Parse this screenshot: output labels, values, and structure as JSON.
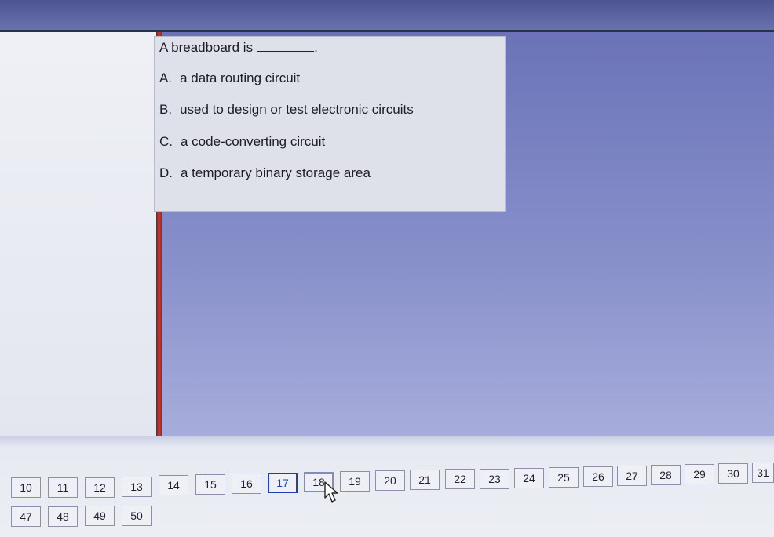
{
  "question": {
    "stem": "A breadboard is",
    "stem_end": ".",
    "options": [
      {
        "letter": "A.",
        "text": "a data routing circuit"
      },
      {
        "letter": "B.",
        "text": "used to design or test electronic circuits"
      },
      {
        "letter": "C.",
        "text": "a code-converting circuit"
      },
      {
        "letter": "D.",
        "text": "a temporary binary storage area"
      }
    ]
  },
  "navigator": {
    "row1": [
      "10",
      "11",
      "12",
      "13",
      "14",
      "15",
      "16",
      "17",
      "18",
      "19",
      "20",
      "21",
      "22",
      "23",
      "24",
      "25",
      "26",
      "27",
      "28",
      "29",
      "30",
      "31"
    ],
    "row2": [
      "47",
      "48",
      "49",
      "50"
    ],
    "current": "17",
    "hovered": "18"
  },
  "colors": {
    "accent_red": "#d43a2e",
    "current_border": "#1d3fb8"
  },
  "icons": [
    "mouse-pointer-icon"
  ]
}
